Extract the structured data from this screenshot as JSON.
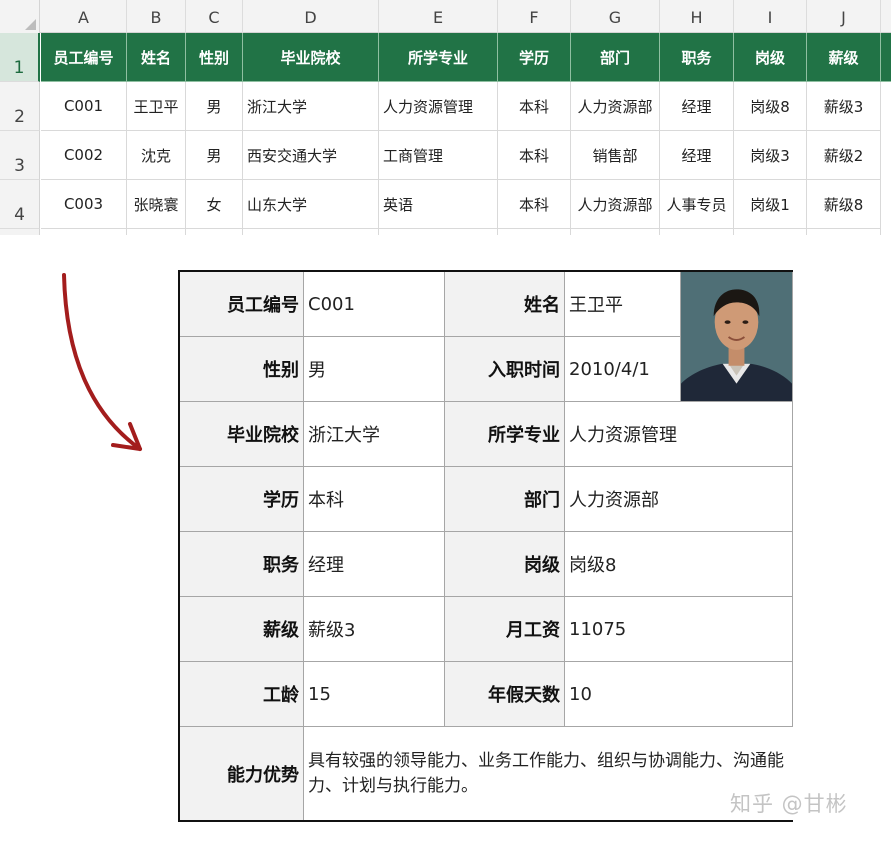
{
  "columns": [
    "A",
    "B",
    "C",
    "D",
    "E",
    "F",
    "G",
    "H",
    "I",
    "J"
  ],
  "rows": [
    "1",
    "2",
    "3",
    "4"
  ],
  "table": {
    "header": [
      "员工编号",
      "姓名",
      "性别",
      "毕业院校",
      "所学专业",
      "学历",
      "部门",
      "职务",
      "岗级",
      "薪级"
    ],
    "records": [
      [
        "C001",
        "王卫平",
        "男",
        "浙江大学",
        "人力资源管理",
        "本科",
        "人力资源部",
        "经理",
        "岗级8",
        "薪级3"
      ],
      [
        "C002",
        "沈克",
        "男",
        "西安交通大学",
        "工商管理",
        "本科",
        "销售部",
        "经理",
        "岗级3",
        "薪级2"
      ],
      [
        "C003",
        "张晓寰",
        "女",
        "山东大学",
        "英语",
        "本科",
        "人力资源部",
        "人事专员",
        "岗级1",
        "薪级8"
      ]
    ]
  },
  "card": {
    "labels": {
      "id": "员工编号",
      "name": "姓名",
      "gender": "性别",
      "hire_date": "入职时间",
      "school": "毕业院校",
      "major": "所学专业",
      "education": "学历",
      "department": "部门",
      "position": "职务",
      "post_level": "岗级",
      "salary_level": "薪级",
      "monthly_salary": "月工资",
      "seniority": "工龄",
      "annual_leave": "年假天数",
      "strengths": "能力优势"
    },
    "values": {
      "id": "C001",
      "name": "王卫平",
      "gender": "男",
      "hire_date": "2010/4/1",
      "school": "浙江大学",
      "major": "人力资源管理",
      "education": "本科",
      "department": "人力资源部",
      "position": "经理",
      "post_level": "岗级8",
      "salary_level": "薪级3",
      "monthly_salary": "11075",
      "seniority": "15",
      "annual_leave": "10",
      "strengths": "具有较强的领导能力、业务工作能力、组织与协调能力、沟通能力、计划与执行能力。"
    }
  },
  "watermark": "知乎 @甘彬",
  "colors": {
    "header_green": "#217346",
    "arrow_red": "#a31d1d"
  }
}
